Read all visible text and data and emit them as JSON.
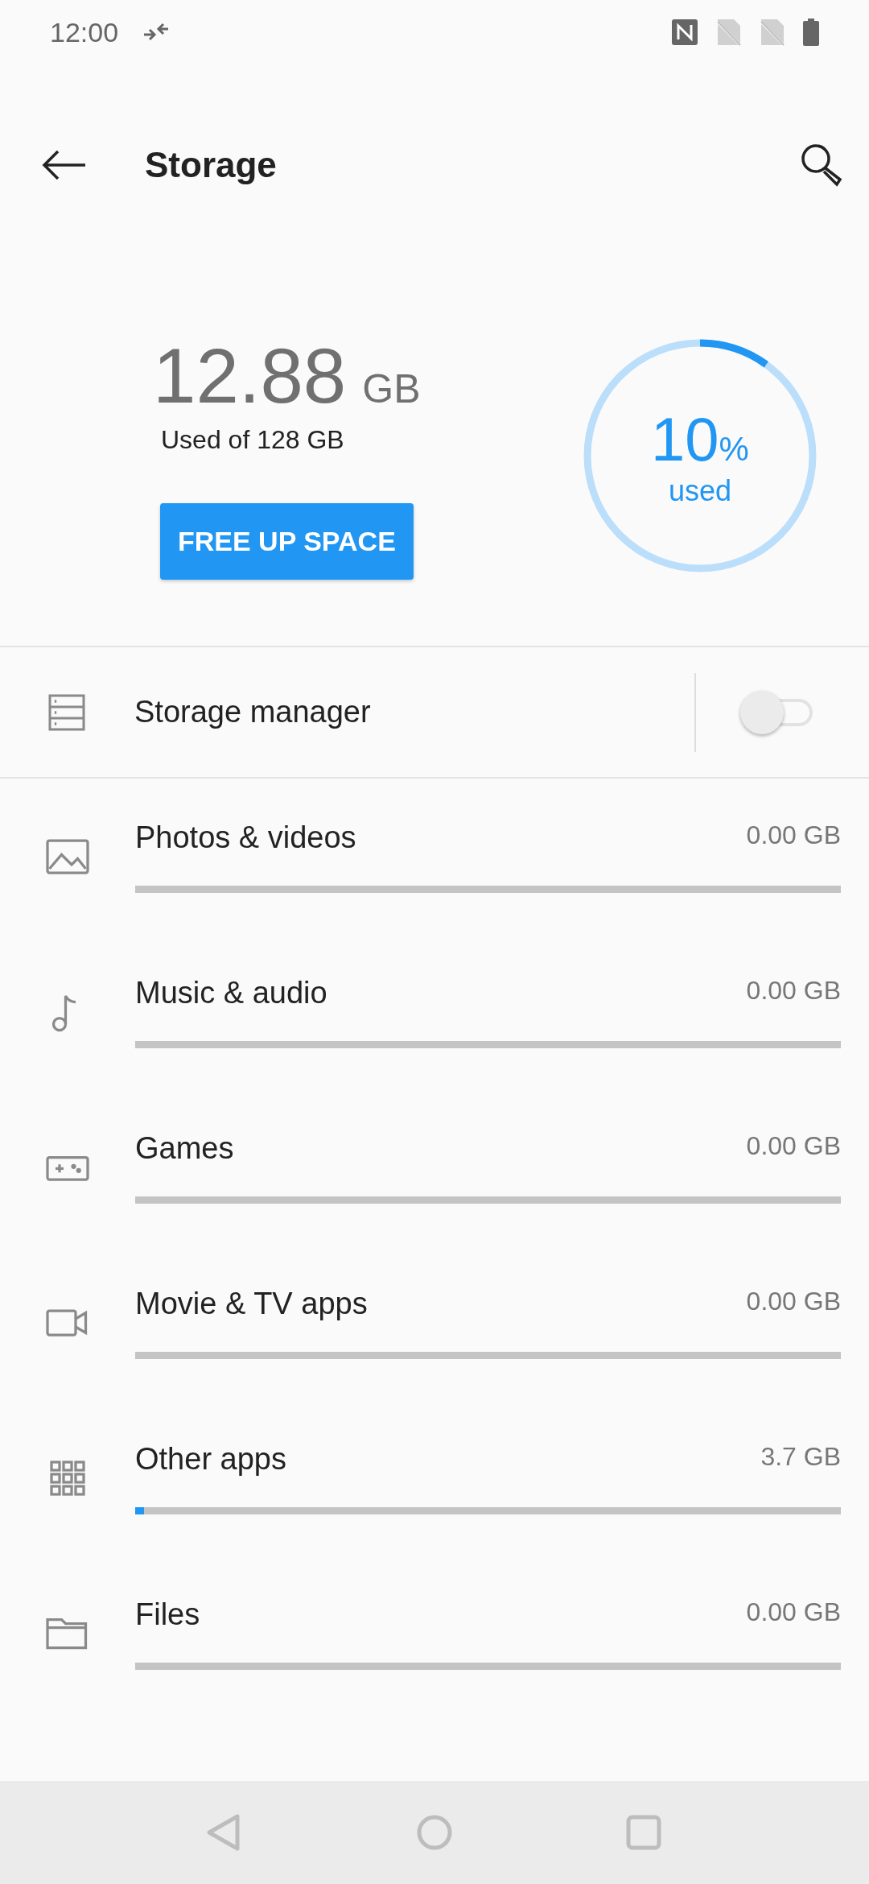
{
  "status_bar": {
    "time": "12:00"
  },
  "toolbar": {
    "title": "Storage"
  },
  "summary": {
    "used_amount": "12.88",
    "used_unit": "GB",
    "caption": "Used of 128 GB",
    "button": "FREE UP SPACE",
    "ring": {
      "level": 0.1,
      "percent": "10",
      "percent_sign": "%",
      "label": "used"
    }
  },
  "storage_manager": {
    "label": "Storage manager",
    "on": false
  },
  "categories": [
    {
      "kind": "photos",
      "label": "Photos & videos",
      "size": "0.00 GB"
    },
    {
      "kind": "music",
      "label": "Music & audio",
      "size": "0.00 GB"
    },
    {
      "kind": "games",
      "label": "Games",
      "size": "0.00 GB"
    },
    {
      "kind": "movies",
      "label": "Movie & TV apps",
      "size": "0.00 GB"
    },
    {
      "kind": "apps",
      "label": "Other apps",
      "size": "3.7 GB",
      "level": 0.013
    },
    {
      "kind": "files",
      "label": "Files",
      "size": "0.00 GB"
    }
  ]
}
